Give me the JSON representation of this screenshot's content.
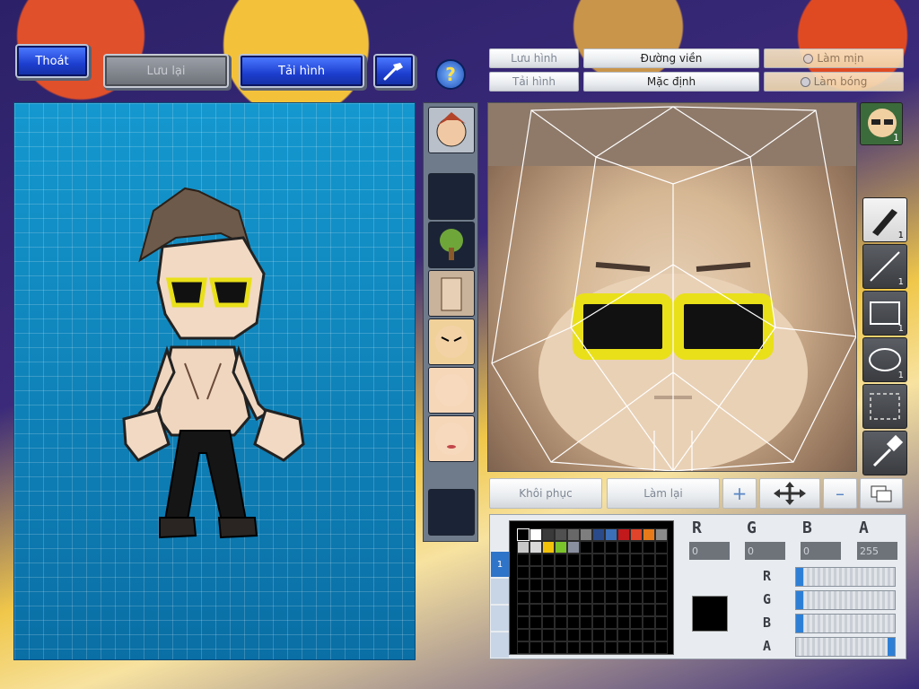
{
  "top_left": {
    "exit_label": "Thoát",
    "save_label": "Lưu lại",
    "reload_label": "Tải hình"
  },
  "help": {
    "glyph": "?"
  },
  "editor_top": {
    "save_label": "Lưu hình",
    "load_label": "Tải hình",
    "outline_label": "Đường viền",
    "default_label": "Mặc định",
    "smooth_label": "Làm mịn",
    "shade_label": "Làm bóng"
  },
  "tools": [
    {
      "name": "pen",
      "count": "1"
    },
    {
      "name": "line",
      "count": "1"
    },
    {
      "name": "rect",
      "count": "1"
    },
    {
      "name": "ellipse",
      "count": "1"
    },
    {
      "name": "select"
    },
    {
      "name": "eyedropper"
    }
  ],
  "face_thumb_count": "1",
  "bottom_controls": {
    "restore_label": "Khôi phục",
    "redo_label": "Làm lại"
  },
  "color": {
    "r_label": "R",
    "g_label": "G",
    "b_label": "B",
    "a_label": "A",
    "r_value": "0",
    "g_value": "0",
    "b_value": "0",
    "a_value": "255",
    "r_level": 0.0,
    "g_level": 0.0,
    "b_level": 0.0,
    "a_level": 1.0,
    "current": "#000000"
  },
  "palette_colors": [
    "#000000",
    "#ffffff",
    "#3a3a3a",
    "#505050",
    "#686868",
    "#7e7e7e",
    "#2a4a8a",
    "#3b6fb8",
    "#c2191c",
    "#e0442a",
    "#e87a1a",
    "#8a8a8a",
    "#c8c8c8",
    "#d8d8d8",
    "#f2c20a",
    "#7bc32a",
    "#8a8fa0"
  ],
  "palette_tab_index": "1"
}
